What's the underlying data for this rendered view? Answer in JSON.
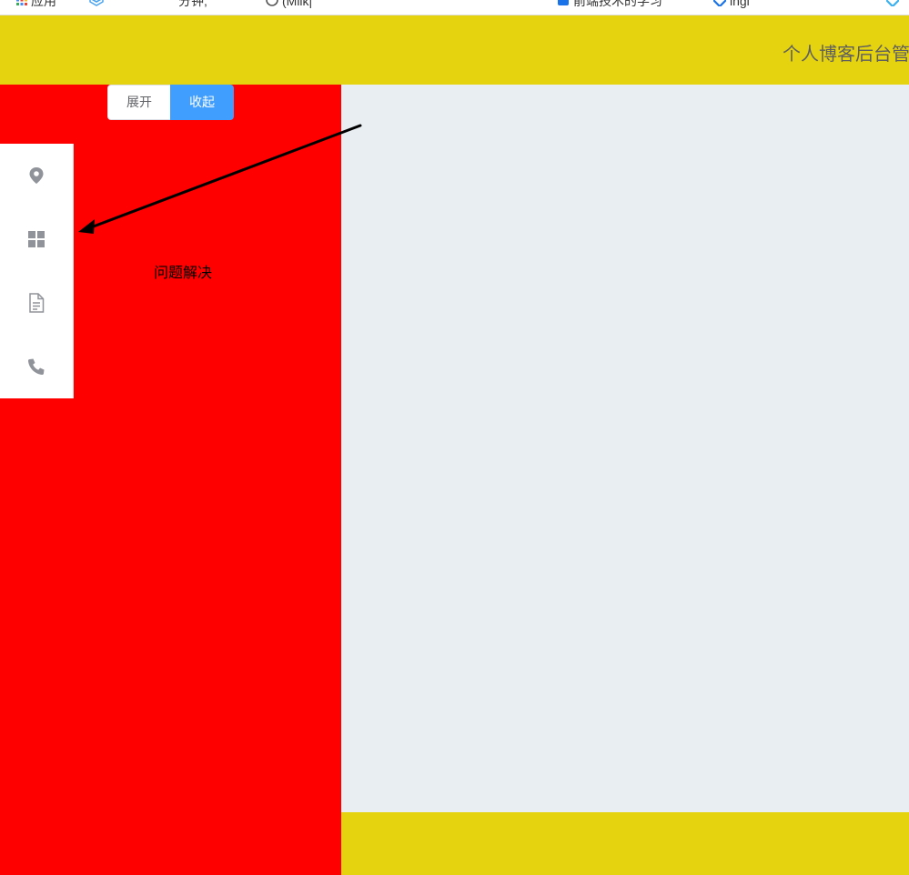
{
  "browser": {
    "bookmarks": [
      {
        "label": "应用",
        "icon": "apps-grid-icon",
        "color": "#e8453c"
      },
      {
        "label": "",
        "icon": "cube-icon",
        "color": "#4aa3f0"
      },
      {
        "label": "分钟,",
        "icon": "",
        "color": ""
      },
      {
        "label": "(Milk|",
        "icon": "github-icon",
        "color": "#555555"
      },
      {
        "label": "",
        "icon": "red-bookmark-icon",
        "color": "#e02020"
      },
      {
        "label": "前端技术的学习",
        "icon": "blue-square-icon",
        "color": "#1a73e8"
      },
      {
        "label": "ingl",
        "icon": "blue-diamond-icon",
        "color": "#1a73e8"
      },
      {
        "label": "",
        "icon": "blue-diamond-icon",
        "color": "#3ab0f0"
      }
    ]
  },
  "header": {
    "title": "个人博客后台管",
    "background": "#e6d30f"
  },
  "aside": {
    "background": "#ff0000",
    "buttons": {
      "expand_label": "展开",
      "collapse_label": "收起"
    },
    "menu": [
      {
        "icon": "location-icon"
      },
      {
        "icon": "menu-grid-icon"
      },
      {
        "icon": "document-icon"
      },
      {
        "icon": "phone-icon"
      }
    ],
    "annotation": "问题解决"
  },
  "main": {
    "background": "#e9eef3"
  },
  "footer": {
    "background": "#e6d30f"
  }
}
